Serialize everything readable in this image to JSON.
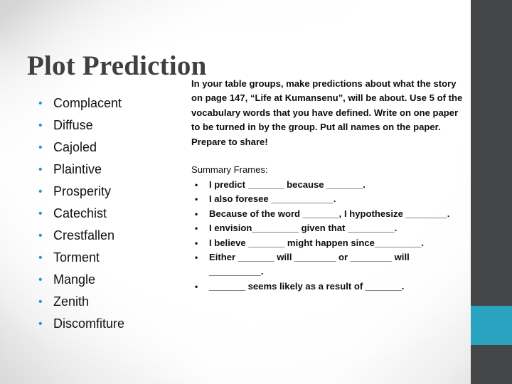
{
  "slide": {
    "title": "Plot Prediction",
    "background_colors": {
      "page": "#ffffff",
      "edge_wash": "#d8d8d8",
      "sidebar_dark": "#444547",
      "sidebar_accent": "#2aa3c0",
      "title_text": "#404040",
      "bullet_accent": "#2a9cb8",
      "body_text": "#0d0d0d"
    }
  },
  "vocabulary": {
    "bullet_glyph": "•",
    "items": [
      {
        "label": "Complacent"
      },
      {
        "label": "Diffuse"
      },
      {
        "label": "Cajoled"
      },
      {
        "label": "Plaintive"
      },
      {
        "label": "Prosperity"
      },
      {
        "label": "Catechist"
      },
      {
        "label": "Crestfallen"
      },
      {
        "label": "Torment"
      },
      {
        "label": "Mangle"
      },
      {
        "label": "Zenith"
      },
      {
        "label": "Discomfiture"
      }
    ]
  },
  "instructions": {
    "paragraph": "In your table groups, make predictions about what the story on page 147, “Life at Kumansenu”, will be about. Use 5 of the vocabulary words that you have defined. Write on one paper to be turned in by the group. Put all names on the paper. Prepare to share!"
  },
  "summary_frames": {
    "heading": "Summary Frames:",
    "bullet_glyph": "•",
    "items": [
      {
        "text": "I predict _______ because _______."
      },
      {
        "text": "I also foresee ____________."
      },
      {
        "text": "Because of the word _______, I hypothesize ________."
      },
      {
        "text": "I envision_________ given that _________."
      },
      {
        "text": "I believe _______ might happen since_________."
      },
      {
        "text": "Either _______ will ________ or ________ will __________."
      },
      {
        "text": "_______ seems likely as a result of _______."
      }
    ]
  }
}
